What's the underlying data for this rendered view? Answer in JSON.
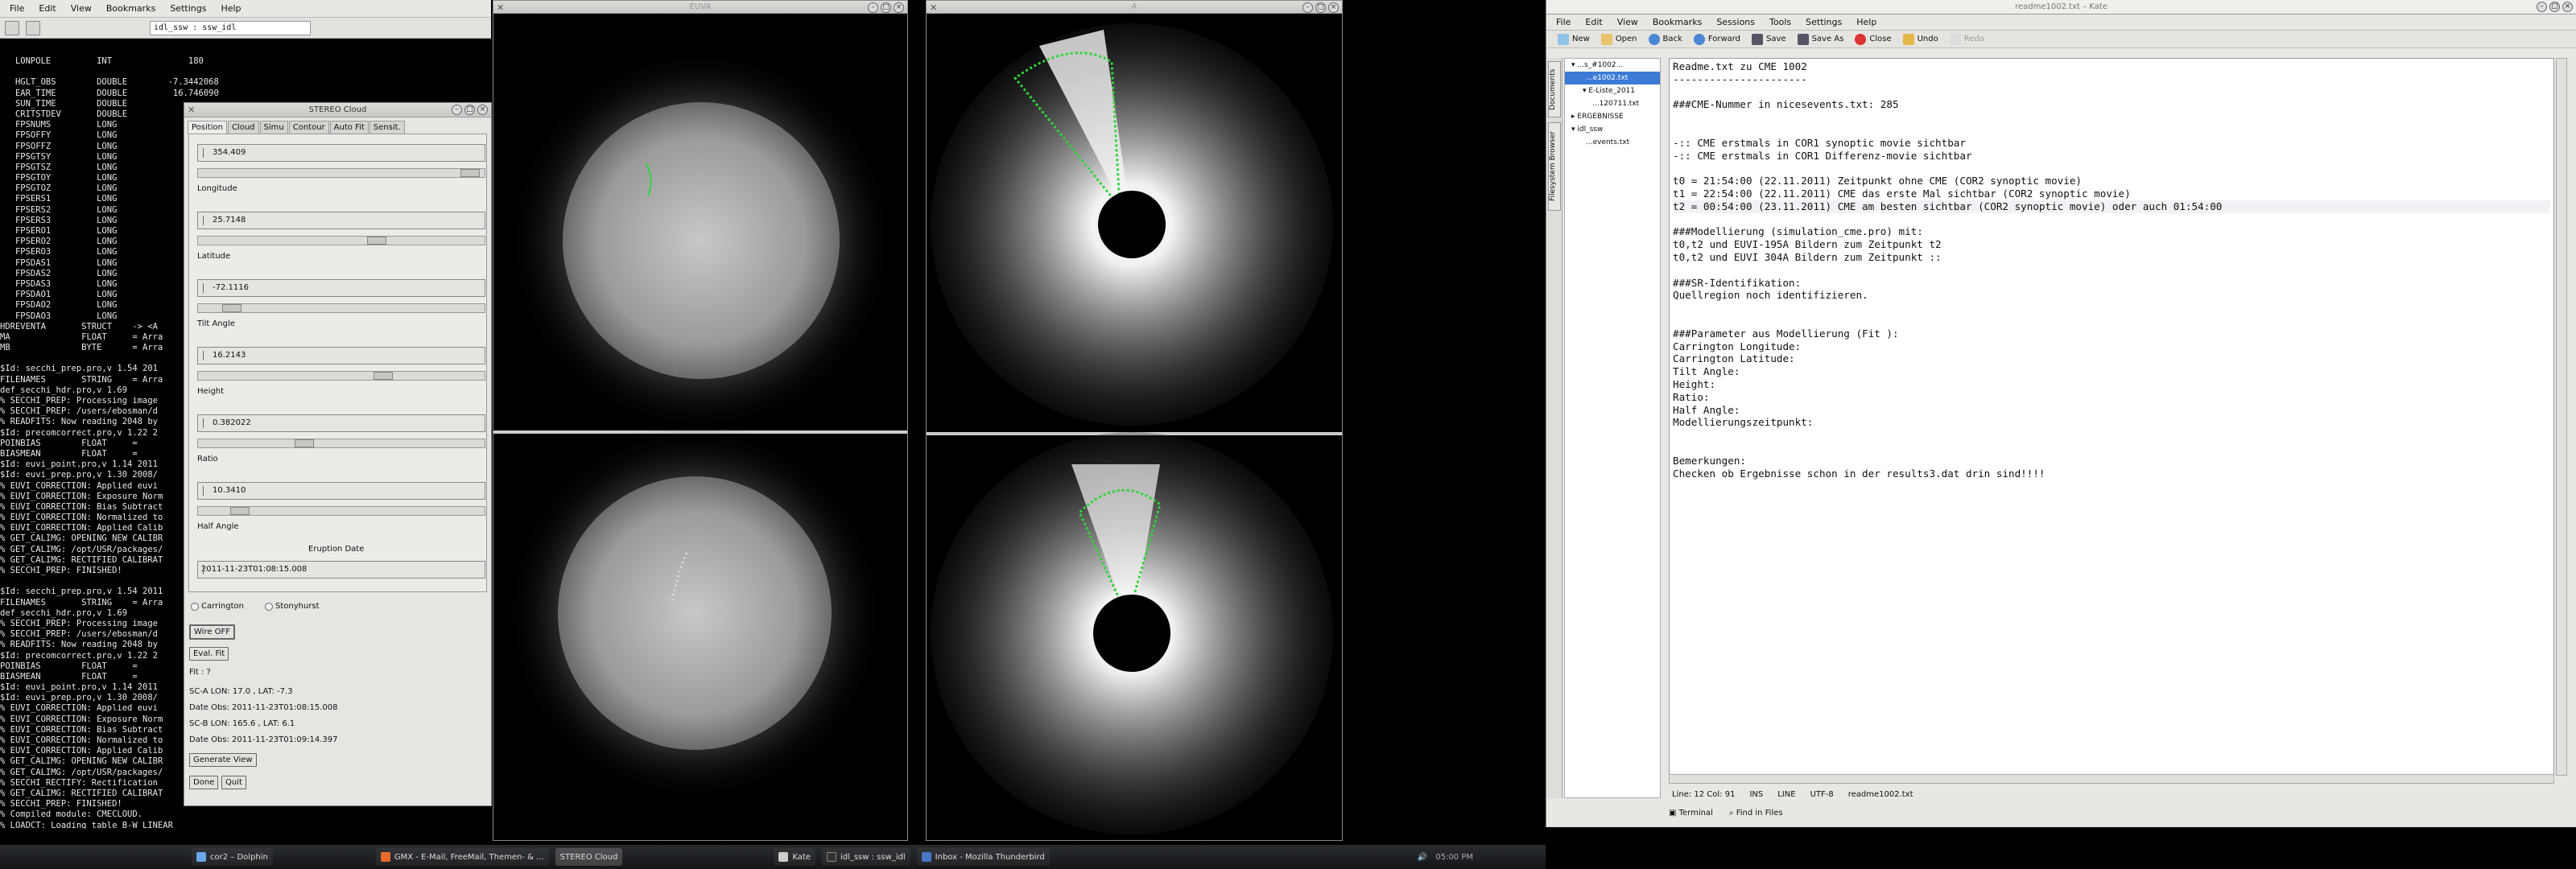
{
  "terminal": {
    "menu": [
      "File",
      "Edit",
      "View",
      "Bookmarks",
      "Settings",
      "Help"
    ],
    "tab_title": "idl_ssw : ssw_idl",
    "lines": [
      "   LONPOLE         INT               180",
      "",
      "   HGLT_OBS        DOUBLE        -7.3442068",
      "   EAR_TIME        DOUBLE         16.746090",
      "   SUN_TIME        DOUBLE",
      "   CRITSTDEV       DOUBLE",
      "   FPSNUMS         LONG",
      "   FPSOFFY         LONG",
      "   FPSOFFZ         LONG",
      "   FPSGTSY         LONG",
      "   FPSGTSZ         LONG",
      "   FPSGTOY         LONG",
      "   FPSGTOZ         LONG",
      "   FPSERS1         LONG",
      "   FPSERS2         LONG",
      "   FPSERS3         LONG",
      "   FPSERO1         LONG",
      "   FPSERO2         LONG",
      "   FPSERO3         LONG",
      "   FPSDAS1         LONG",
      "   FPSDAS2         LONG",
      "   FPSDAS3         LONG",
      "   FPSDAO1         LONG",
      "   FPSDAO2         LONG",
      "   FPSDAO3         LONG",
      "HDREVENTA       STRUCT    -> <A",
      "MA              FLOAT     = Arra",
      "MB              BYTE      = Arra",
      "",
      "$Id: secchi_prep.pro,v 1.54 201",
      "FILENAMES       STRING    = Arra",
      "def_secchi_hdr.pro,v 1.69",
      "% SECCHI_PREP: Processing image",
      "% SECCHI_PREP: /users/ebosman/d",
      "% READFITS: Now reading 2048 by",
      "$Id: precomcorrect.pro,v 1.22 2",
      "POINBIAS        FLOAT     =",
      "BIASMEAN        FLOAT     =",
      "$Id: euvi_point.pro,v 1.14 2011",
      "$Id: euvi_prep.pro,v 1.30 2008/",
      "% EUVI_CORRECTION: Applied euvi",
      "% EUVI_CORRECTION: Exposure Norm",
      "% EUVI_CORRECTION: Bias Subtract",
      "% EUVI_CORRECTION: Normalized to",
      "% EUVI_CORRECTION: Applied Calib",
      "% GET_CALIMG: OPENING NEW CALIBR",
      "% GET_CALIMG: /opt/USR/packages/",
      "% GET_CALIMG: RECTIFIED CALIBRAT",
      "% SECCHI_PREP: FINISHED!",
      "",
      "$Id: secchi_prep.pro,v 1.54 2011",
      "FILENAMES       STRING    = Arra",
      "def_secchi_hdr.pro,v 1.69",
      "% SECCHI_PREP: Processing image",
      "% SECCHI_PREP: /users/ebosman/d",
      "% READFITS: Now reading 2048 by",
      "$Id: precomcorrect.pro,v 1.22 2",
      "POINBIAS        FLOAT     =",
      "BIASMEAN        FLOAT     =",
      "$Id: euvi_point.pro,v 1.14 2011",
      "$Id: euvi_prep.pro,v 1.30 2008/",
      "% EUVI_CORRECTION: Applied euvi",
      "% EUVI_CORRECTION: Exposure Norm",
      "% EUVI_CORRECTION: Bias Subtract",
      "% EUVI_CORRECTION: Normalized to",
      "% EUVI_CORRECTION: Applied Calib",
      "% GET_CALIMG: OPENING NEW CALIBR",
      "% GET_CALIMG: /opt/USR/packages/",
      "% SECCHI_RECTIFY: Rectification",
      "% GET_CALIMG: RECTIFIED CALIBRAT",
      "% SECCHI_PREP: FINISHED!",
      "% Compiled module: CMECLOUD.",
      "% LOADCT: Loading table B-W LINEAR"
    ]
  },
  "stereo_cloud": {
    "title": "STEREO Cloud",
    "tabs": [
      "Position",
      "Cloud",
      "Simu",
      "Contour",
      "Auto Fit",
      "Sensit."
    ],
    "fields": [
      {
        "label": "",
        "value": "354.409"
      },
      {
        "label": "Longitude",
        "value": "25.7148"
      },
      {
        "label": "Latitude",
        "value": "-72.1116"
      },
      {
        "label": "Tilt Angle",
        "value": "16.2143"
      },
      {
        "label": "Height",
        "value": "0.382022"
      },
      {
        "label": "Ratio",
        "value": "10.3410"
      },
      {
        "label": "Half Angle",
        "value": ""
      }
    ],
    "eruption_label": "Eruption Date",
    "eruption_value": "2011-11-23T01:08:15.008",
    "radio_carrington": "Carrington",
    "radio_stonyhurst": "Stonyhurst",
    "wire_off": "Wire OFF",
    "eval_fit": "Eval. Fit",
    "fit_label": "Fit : ?",
    "sc_a": "SC-A LON:   17.0 , LAT:  -7.3",
    "date_a": "Date Obs: 2011-11-23T01:08:15.008",
    "sc_b": "SC-B LON:  165.6 , LAT:   6.1",
    "date_b": "Date Obs: 2011-11-23T01:09:14.397",
    "generate_view": "Generate View",
    "done": "Done",
    "quit": "Quit"
  },
  "image_windows": {
    "euvi_title": "EUVA",
    "cor_title": "A"
  },
  "kate": {
    "title": "readme1002.txt – Kate",
    "menu": [
      "File",
      "Edit",
      "View",
      "Bookmarks",
      "Sessions",
      "Tools",
      "Settings",
      "Help"
    ],
    "toolbar": [
      "New",
      "Open",
      "Back",
      "Forward",
      "Save",
      "Save As",
      "Close",
      "Undo",
      "Redo"
    ],
    "side_tabs": [
      "Documents",
      "Filesystem Browser"
    ],
    "tree": [
      "...s_#1002...",
      "...e1002.txt",
      "E-Liste_2011",
      "...120711.txt",
      "ERGEBNISSE",
      "idl_ssw",
      "...events.txt"
    ],
    "lines": [
      "Readme.txt zu CME 1002",
      "----------------------",
      "",
      "###CME-Nummer in nicesevents.txt: 285",
      "",
      "",
      "-:: CME erstmals in COR1 synoptic movie sichtbar",
      "-:: CME erstmals in COR1 Differenz-movie sichtbar",
      "",
      "t0 = 21:54:00 (22.11.2011) Zeitpunkt ohne CME (COR2 synoptic movie)",
      "t1 = 22:54:00 (22.11.2011) CME das erste Mal sichtbar (COR2 synoptic movie)",
      "t2 = 00:54:00 (23.11.2011) CME am besten sichtbar (COR2 synoptic movie) oder auch 01:54:00",
      "",
      "###Modellierung (simulation_cme.pro) mit:",
      "t0,t2 und EUVI-195A Bildern zum Zeitpunkt t2",
      "t0,t2 und EUVI 304A Bildern zum Zeitpunkt ::",
      "",
      "###SR-Identifikation:",
      "Quellregion noch identifizieren.",
      "",
      "",
      "###Parameter aus Modellierung (Fit ):",
      "Carrington Longitude:",
      "Carrington Latitude:",
      "Tilt Angle:",
      "Height:",
      "Ratio:",
      "Half Angle:",
      "Modellierungszeitpunkt:",
      "",
      "",
      "Bemerkungen:",
      "Checken ob Ergebnisse schon in der results3.dat drin sind!!!!"
    ],
    "status": [
      "Line: 12 Col: 91",
      "INS",
      "LINE",
      "UTF-8",
      "readme1002.txt"
    ],
    "bottom": [
      "Terminal",
      "Find in Files"
    ]
  },
  "taskbar": {
    "tasks": [
      "cor2 – Dolphin",
      "GMX - E-Mail, FreeMail, Themen- & ...",
      "STEREO Cloud",
      "Kate",
      "idl_ssw : ssw_idl",
      "Inbox - Mozilla Thunderbird"
    ],
    "clock": "05:00 PM"
  }
}
